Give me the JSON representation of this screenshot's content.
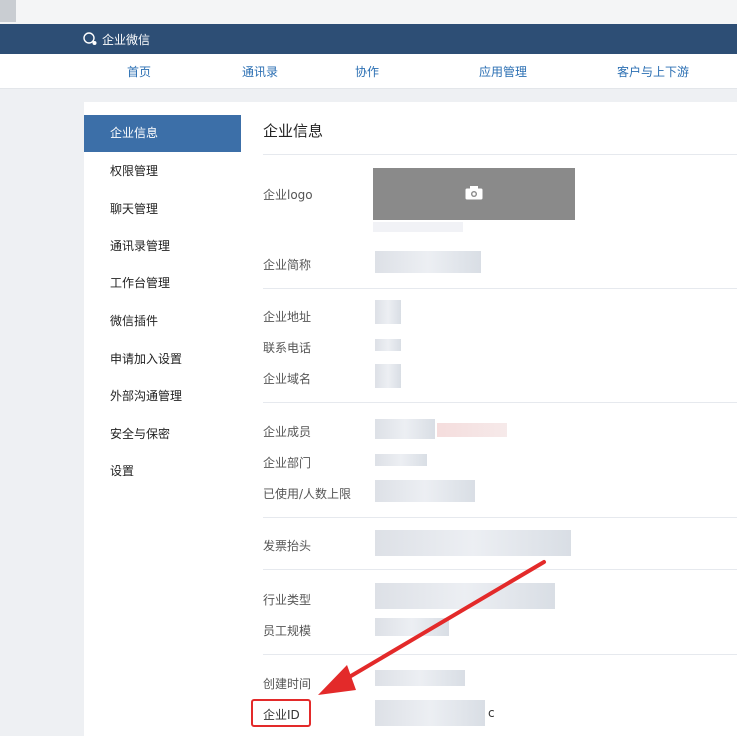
{
  "header": {
    "brand": "企业微信"
  },
  "nav": {
    "items": [
      "首页",
      "通讯录",
      "协作",
      "应用管理",
      "客户与上下游"
    ]
  },
  "sidebar": {
    "items": [
      "企业信息",
      "权限管理",
      "聊天管理",
      "通讯录管理",
      "工作台管理",
      "微信插件",
      "申请加入设置",
      "外部沟通管理",
      "安全与保密",
      "设置"
    ],
    "active": "企业信息"
  },
  "main": {
    "title": "企业信息",
    "fields": {
      "logo": "企业logo",
      "short_name": "企业简称",
      "address": "企业地址",
      "phone": "联系电话",
      "domain": "企业域名",
      "members": "企业成员",
      "departments": "企业部门",
      "used_limit": "已使用/人数上限",
      "invoice": "发票抬头",
      "industry": "行业类型",
      "staff_size": "员工规模",
      "created_time": "创建时间",
      "corp_id": "企业ID"
    },
    "corp_id_suffix": "c"
  },
  "colors": {
    "header_bg": "#2d4e75",
    "active_bg": "#3c6fa8",
    "highlight": "#e32a2a",
    "nav_link": "#2b6fb3"
  }
}
